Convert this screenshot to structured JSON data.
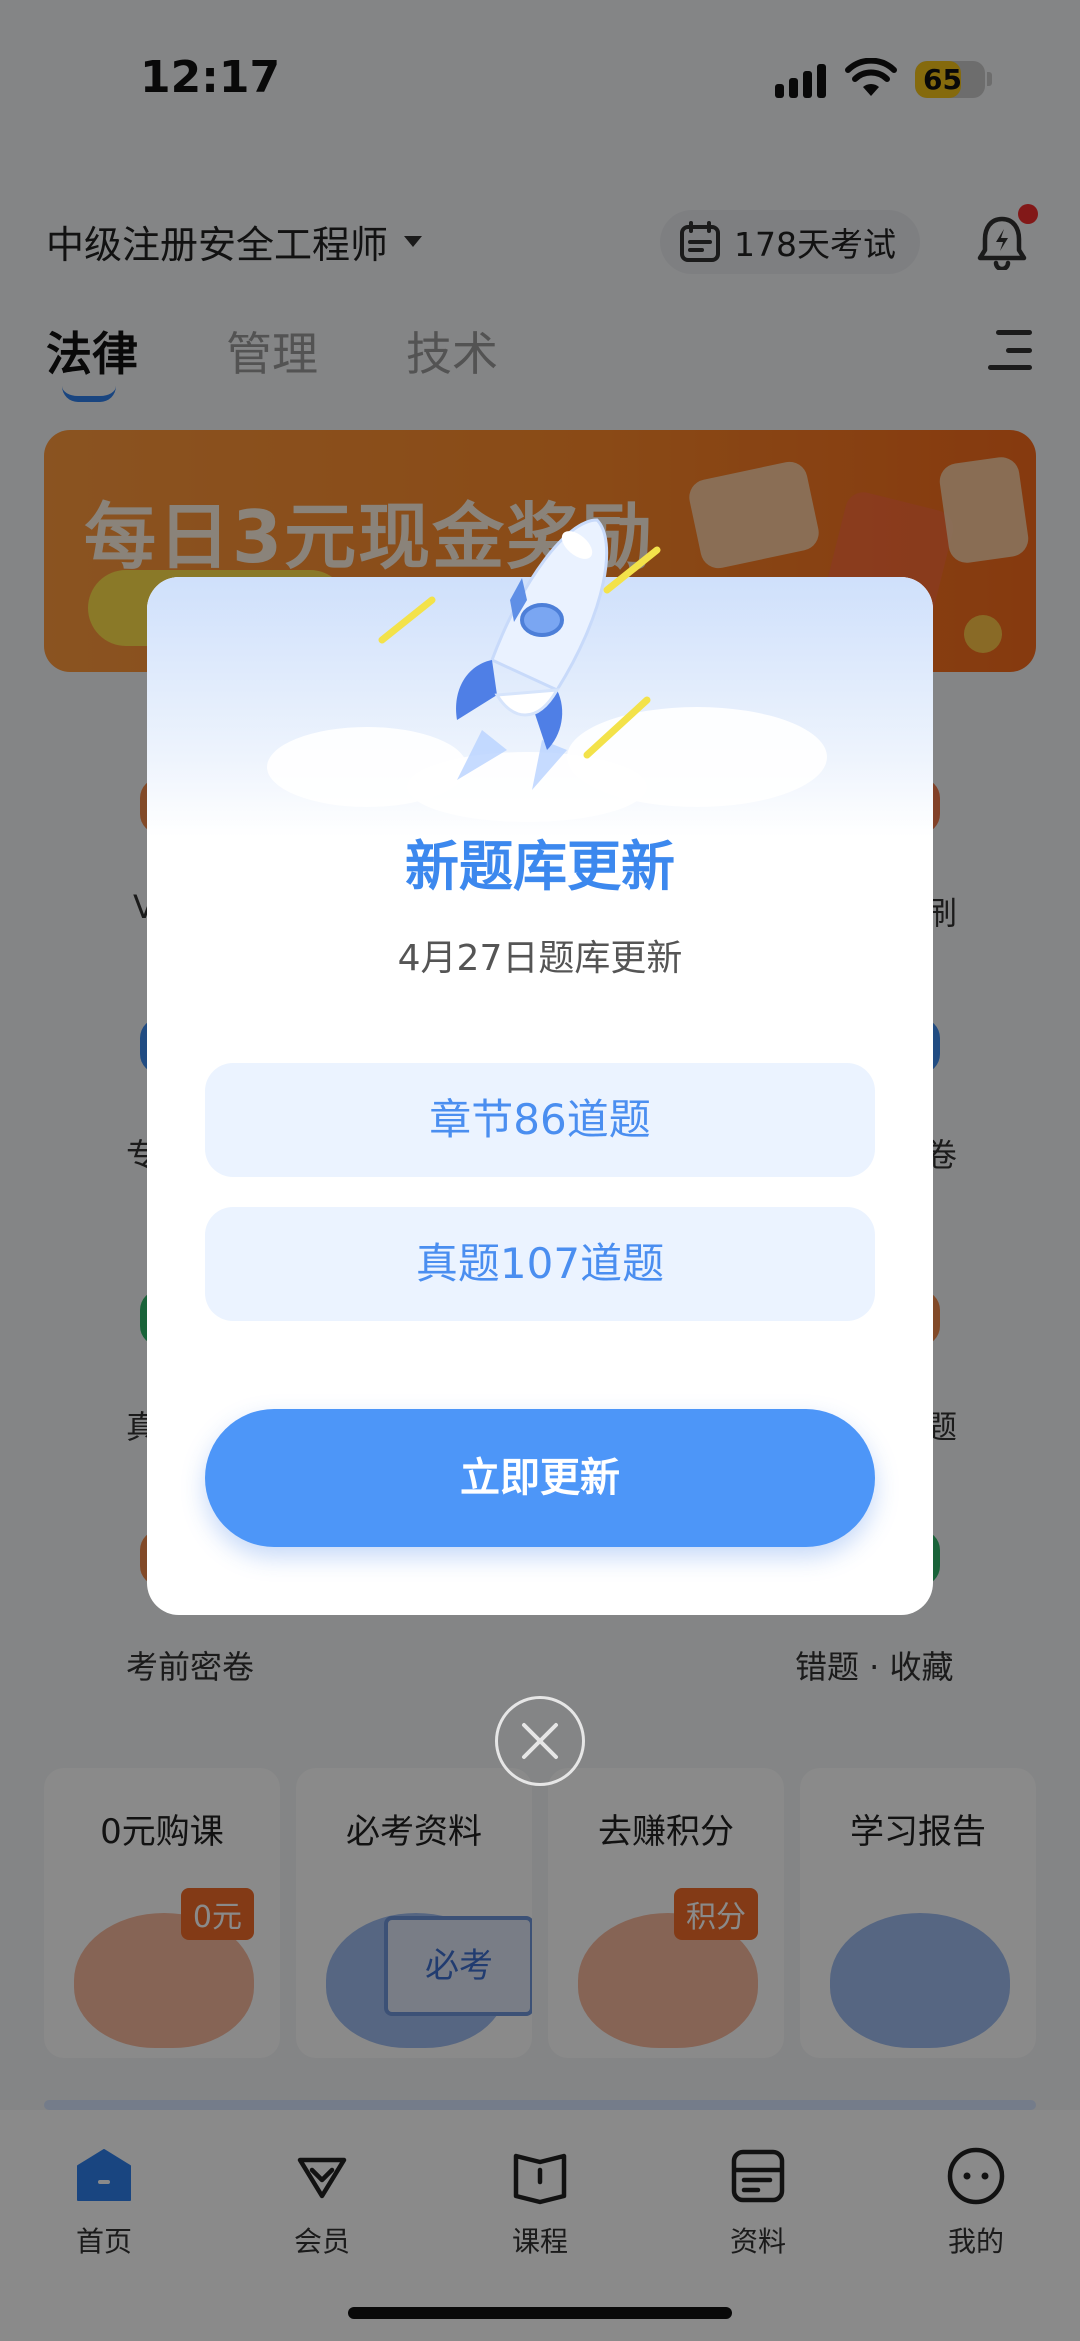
{
  "status_bar": {
    "time": "12:17",
    "battery": "65",
    "battery_level_percent": 65
  },
  "header": {
    "exam_name": "中级注册安全工程师",
    "countdown": "178天考试"
  },
  "tabs": [
    {
      "label": "法律"
    },
    {
      "label": "管理"
    },
    {
      "label": "技术"
    }
  ],
  "banner": {
    "title": "每日3元现金奖励"
  },
  "grid": {
    "partial_labels": [
      {
        "text": "V"
      },
      {
        "text": "刷"
      },
      {
        "text": "专"
      },
      {
        "text": "卷"
      },
      {
        "text": "真"
      },
      {
        "text": "题"
      }
    ],
    "bottom_left": "考前密卷",
    "bottom_right": "错题 · 收藏"
  },
  "cards": [
    {
      "title": "0元购课",
      "badge": "0元"
    },
    {
      "title": "必考资料",
      "board": "必考"
    },
    {
      "title": "去赚积分",
      "badge": "积分"
    },
    {
      "title": "学习报告"
    }
  ],
  "bottom_nav": [
    {
      "label": "首页"
    },
    {
      "label": "会员"
    },
    {
      "label": "课程"
    },
    {
      "label": "资料"
    },
    {
      "label": "我的"
    }
  ],
  "modal": {
    "title": "新题库更新",
    "subtitle": "4月27日题库更新",
    "items": [
      {
        "label": "章节86道题"
      },
      {
        "label": "真题107道题"
      }
    ],
    "button": "立即更新"
  },
  "icons": {
    "status": [
      "signal-icon",
      "wifi-icon",
      "battery-icon"
    ],
    "header": [
      "calendar-icon",
      "bell-icon",
      "caret-down-icon",
      "menu-icon"
    ],
    "modal": [
      "rocket-icon",
      "close-icon"
    ]
  },
  "colors": {
    "accent": "#4d96f8",
    "modal_title": "#3c88ee",
    "banner": "#ff8a2a",
    "notification_dot": "#f02d2d",
    "battery": "#f5c518"
  }
}
